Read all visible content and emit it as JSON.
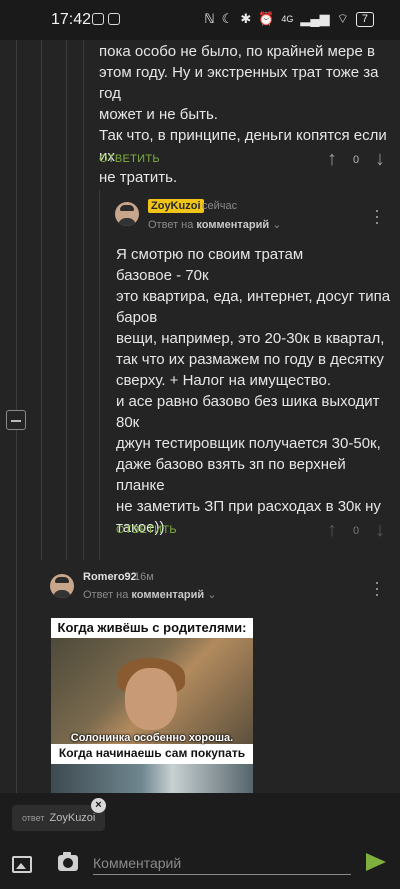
{
  "status_bar": {
    "time": "17:42",
    "network": "4G",
    "battery": "7"
  },
  "comment_top": {
    "lines": [
      "пока особо не было, по крайней мере в",
      "этом году. Ну и экстренных трат тоже за год",
      "может и не быть.",
      "Так что, в принципе, деньги копятся если их",
      "не тратить."
    ],
    "reply_label": "ОТВЕТИТЬ",
    "votes": "0"
  },
  "comment_zoy": {
    "author": "ZoyKuzoi",
    "time": "сейчас",
    "meta_prefix": "Ответ на",
    "meta_target": "комментарий",
    "lines": [
      "Я смотрю по своим тратам",
      "базовое - 70к",
      "это квартира, еда, интернет, досуг типа",
      "баров",
      "вещи, например, это 20-30к в квартал,",
      "так что их размажем по году в десятку",
      "сверху. + Налог на имущество.",
      "и асе равно базово без шика выходит",
      "80к",
      "джун тестировщик получается 30-50к,",
      "даже базово взять зп по верхней планке",
      "не заметить ЗП при расходах в 30к ну",
      "такое))"
    ],
    "reply_label": "ОТВЕТИТЬ",
    "votes": "0"
  },
  "comment_romero": {
    "author": "Romero92",
    "time": "16м",
    "meta_prefix": "Ответ на",
    "meta_target": "комментарий",
    "meme": {
      "caption1": "Когда живёшь с родителями:",
      "subtitle": "Солонинка особенно хороша.",
      "caption2": "Когда начинаешь сам покупать еду:"
    }
  },
  "composer": {
    "reply_to_prefix": "ответ",
    "reply_to_user": "ZoyKuzoi",
    "placeholder": "Комментарий"
  },
  "colors": {
    "accent": "#7fb03e",
    "badge": "#f0c419",
    "background": "#242424"
  }
}
